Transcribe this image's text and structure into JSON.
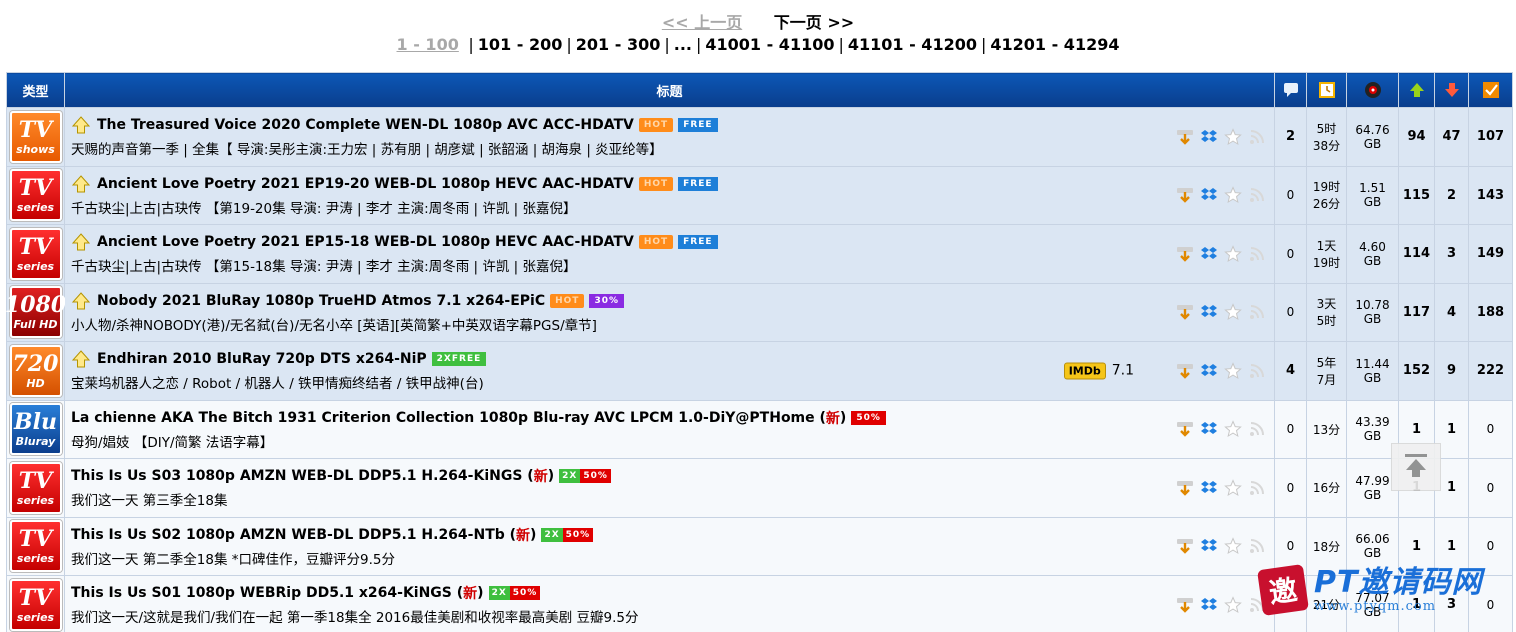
{
  "pager": {
    "prev": "<< 上一页",
    "next": "下一页 >>",
    "current": "1 - 100",
    "pages": [
      "101 - 200",
      "201 - 300",
      "...",
      "41001 - 41100",
      "41101 - 41200",
      "41201 - 41294"
    ]
  },
  "header": {
    "type": "类型",
    "title": "标题"
  },
  "colors": {
    "header_bg": "#0a4aa4",
    "sticky_row": "#dbe6f3",
    "normal_row": "#f6f9fc"
  },
  "rows": [
    {
      "cat_big": "TV",
      "cat_small": "shows",
      "cat_class": "cat-tvshows",
      "sticky": true,
      "name": "The Treasured Voice 2020 Complete WEN-DL 1080p AVC ACC-HDATV",
      "tags": [
        "HOT",
        "FREE"
      ],
      "new": "",
      "subtitle": "天赐的声音第一季 | 全集【 导演:吴彤主演:王力宏 | 苏有朋 | 胡彦斌 | 张韶涵 | 胡海泉 | 炎亚纶等】",
      "imdb": "",
      "comments": "2",
      "time1": "5时",
      "time2": "38分",
      "size1": "64.76",
      "size2": "GB",
      "seeders": "94",
      "leechers": "47",
      "completed": "107"
    },
    {
      "cat_big": "TV",
      "cat_small": "series",
      "cat_class": "cat-tvseries",
      "sticky": true,
      "name": "Ancient Love Poetry 2021 EP19-20 WEB-DL 1080p HEVC AAC-HDATV",
      "tags": [
        "HOT",
        "FREE"
      ],
      "new": "",
      "subtitle": "千古玦尘|上古|古玦传 【第19-20集 导演: 尹涛 | 李才 主演:周冬雨 | 许凯 | 张嘉倪】",
      "imdb": "",
      "comments": "0",
      "time1": "19时",
      "time2": "26分",
      "size1": "1.51",
      "size2": "GB",
      "seeders": "115",
      "leechers": "2",
      "completed": "143"
    },
    {
      "cat_big": "TV",
      "cat_small": "series",
      "cat_class": "cat-tvseries",
      "sticky": true,
      "name": "Ancient Love Poetry 2021 EP15-18 WEB-DL 1080p HEVC AAC-HDATV",
      "tags": [
        "HOT",
        "FREE"
      ],
      "new": "",
      "subtitle": "千古玦尘|上古|古玦传 【第15-18集 导演: 尹涛 | 李才 主演:周冬雨 | 许凯 | 张嘉倪】",
      "imdb": "",
      "comments": "0",
      "time1": "1天",
      "time2": "19时",
      "size1": "4.60",
      "size2": "GB",
      "seeders": "114",
      "leechers": "3",
      "completed": "149"
    },
    {
      "cat_big": "1080",
      "cat_small": "Full HD",
      "cat_class": "cat-1080",
      "sticky": true,
      "name": "Nobody 2021 BluRay 1080p TrueHD Atmos 7.1 x264-EPiC",
      "tags": [
        "HOT",
        "30%"
      ],
      "new": "",
      "subtitle": "小人物/杀神NOBODY(港)/无名弑(台)/无名小卒 [英语][英简繁+中英双语字幕PGS/章节]",
      "imdb": "",
      "comments": "0",
      "time1": "3天",
      "time2": "5时",
      "size1": "10.78",
      "size2": "GB",
      "seeders": "117",
      "leechers": "4",
      "completed": "188"
    },
    {
      "cat_big": "720",
      "cat_small": "HD",
      "cat_class": "cat-720",
      "sticky": true,
      "name": "Endhiran 2010 BluRay 720p DTS x264-NiP",
      "tags": [
        "2XFREE"
      ],
      "new": "",
      "subtitle": "宝莱坞机器人之恋 / Robot / 机器人 / 铁甲情痴终结者 / 铁甲战神(台)",
      "imdb": "7.1",
      "comments": "4",
      "time1": "5年",
      "time2": "7月",
      "size1": "11.44",
      "size2": "GB",
      "seeders": "152",
      "leechers": "9",
      "completed": "222"
    },
    {
      "cat_big": "Blu",
      "cat_small": "Bluray",
      "cat_class": "cat-bluray",
      "sticky": false,
      "name": "La chienne AKA The Bitch 1931 Criterion Collection 1080p Blu-ray AVC LPCM 1.0-DiY@PTHome",
      "tags": [
        "50%"
      ],
      "new": "新",
      "subtitle": "母狗/娼妓 【DIY/简繁 法语字幕】",
      "imdb": "",
      "comments": "0",
      "time1": "13分",
      "time2": "",
      "size1": "43.39",
      "size2": "GB",
      "seeders": "1",
      "leechers": "1",
      "completed": "0"
    },
    {
      "cat_big": "TV",
      "cat_small": "series",
      "cat_class": "cat-tvseries",
      "sticky": false,
      "name": "This Is Us S03 1080p AMZN WEB-DL DDP5.1 H.264-KiNGS",
      "tags": [
        "2X50%"
      ],
      "new": "新",
      "subtitle": "我们这一天 第三季全18集",
      "imdb": "",
      "comments": "0",
      "time1": "16分",
      "time2": "",
      "size1": "47.99",
      "size2": "GB",
      "seeders": "1",
      "leechers": "1",
      "completed": "0"
    },
    {
      "cat_big": "TV",
      "cat_small": "series",
      "cat_class": "cat-tvseries",
      "sticky": false,
      "name": "This Is Us S02 1080p AMZN WEB-DL DDP5.1 H.264-NTb",
      "tags": [
        "2X50%"
      ],
      "new": "新",
      "subtitle": "我们这一天 第二季全18集 *口碑佳作，豆瓣评分9.5分",
      "imdb": "",
      "comments": "0",
      "time1": "18分",
      "time2": "",
      "size1": "66.06",
      "size2": "GB",
      "seeders": "1",
      "leechers": "1",
      "completed": "0"
    },
    {
      "cat_big": "TV",
      "cat_small": "series",
      "cat_class": "cat-tvseries",
      "sticky": false,
      "name": "This Is Us S01 1080p WEBRip DD5.1 x264-KiNGS",
      "tags": [
        "2X50%"
      ],
      "new": "新",
      "subtitle": "我们这一天/这就是我们/我们在一起 第一季18集全 2016最佳美剧和收视率最高美剧 豆瓣9.5分",
      "imdb": "",
      "comments": "0",
      "time1": "21分",
      "time2": "",
      "size1": "77.07",
      "size2": "GB",
      "seeders": "1",
      "leechers": "3",
      "completed": "0"
    }
  ],
  "watermark": {
    "seal": "邀",
    "text": "PT邀请码网",
    "url": "www.ptyqm.com"
  }
}
